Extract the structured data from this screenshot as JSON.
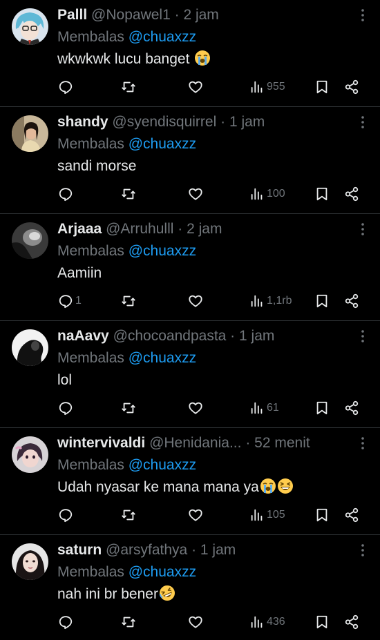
{
  "colors": {
    "background": "#000000",
    "text": "#e7e9ea",
    "muted": "#71767b",
    "mention": "#1d9bf0",
    "divider": "#2f3336"
  },
  "replies": [
    {
      "name": "Palll",
      "handle": "@Nopawel1",
      "dot": "·",
      "time": "2 jam",
      "replying_prefix": "Membalas",
      "replying_to": "@chuaxzz",
      "text": "wkwkwk lucu banget",
      "emojis": [
        "loudly-crying-face"
      ],
      "reply_count": "",
      "views": "955",
      "avatar_icon": "anime-avatar"
    },
    {
      "name": "shandy",
      "handle": "@syendisquirrel",
      "dot": "·",
      "time": "1 jam",
      "replying_prefix": "Membalas",
      "replying_to": "@chuaxzz",
      "text": "sandi morse",
      "emojis": [],
      "reply_count": "",
      "views": "100",
      "avatar_icon": "person-photo-avatar"
    },
    {
      "name": "Arjaaa",
      "handle": "@Arruhulll",
      "dot": "·",
      "time": "2 jam",
      "replying_prefix": "Membalas",
      "replying_to": "@chuaxzz",
      "text": "Aamiin",
      "emojis": [],
      "reply_count": "1",
      "views": "1,1rb",
      "avatar_icon": "dark-photo-avatar"
    },
    {
      "name": "naAavy",
      "handle": "@chocoandpasta",
      "dot": "·",
      "time": "1 jam",
      "replying_prefix": "Membalas",
      "replying_to": "@chuaxzz",
      "text": "lol",
      "emojis": [],
      "reply_count": "",
      "views": "61",
      "avatar_icon": "silhouette-avatar"
    },
    {
      "name": "wintervivaldi",
      "handle": "@Henidania...",
      "dot": "·",
      "time": "52 menit",
      "replying_prefix": "Membalas",
      "replying_to": "@chuaxzz",
      "text": "Udah nyasar ke mana mana ya",
      "emojis": [
        "loudly-crying-face",
        "grinning-squinting-face"
      ],
      "reply_count": "",
      "views": "105",
      "avatar_icon": "girl-photo-avatar"
    },
    {
      "name": "saturn",
      "handle": "@arsyfathya",
      "dot": "·",
      "time": "1 jam",
      "replying_prefix": "Membalas",
      "replying_to": "@chuaxzz",
      "text": "nah ini br bener",
      "emojis": [
        "rolling-on-floor-laughing-face"
      ],
      "reply_count": "",
      "views": "436",
      "avatar_icon": "woman-photo-avatar"
    }
  ],
  "icons": {
    "reply": "reply-icon",
    "retweet": "retweet-icon",
    "like": "heart-icon",
    "views": "views-icon",
    "bookmark": "bookmark-icon",
    "share": "share-icon",
    "more": "more-options-icon"
  }
}
